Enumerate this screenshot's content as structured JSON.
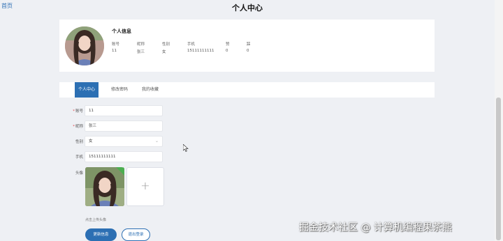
{
  "header": {
    "back_label": "首页",
    "title": "个人中心"
  },
  "profile": {
    "section_title": "个人信息",
    "stats": [
      {
        "label": "账号",
        "value": "11"
      },
      {
        "label": "昵称",
        "value": "张三"
      },
      {
        "label": "性别",
        "value": "女"
      },
      {
        "label": "手机",
        "value": "15111111111"
      },
      {
        "label": "赞",
        "value": "0"
      },
      {
        "label": "踩",
        "value": "0"
      }
    ]
  },
  "tabs": [
    {
      "label": "个人中心",
      "active": true
    },
    {
      "label": "修改密码",
      "active": false
    },
    {
      "label": "我的收藏",
      "active": false
    }
  ],
  "form": {
    "account": {
      "label": "账号",
      "value": "11"
    },
    "nickname": {
      "label": "昵称",
      "value": "张三"
    },
    "gender": {
      "label": "性别",
      "value": "女"
    },
    "phone": {
      "label": "手机",
      "value": "15111111111"
    },
    "avatar": {
      "label": "头像",
      "hint": "点击上传头像",
      "add_symbol": "+"
    }
  },
  "buttons": {
    "update": "更新信息",
    "logout": "退出登录"
  },
  "watermark": "掘金技术社区 @ 计算机编程果茶熊",
  "colors": {
    "primary": "#2c6fb3",
    "required": "#e0454a",
    "upload_ok": "#4cae50",
    "background": "#eef0f4"
  }
}
